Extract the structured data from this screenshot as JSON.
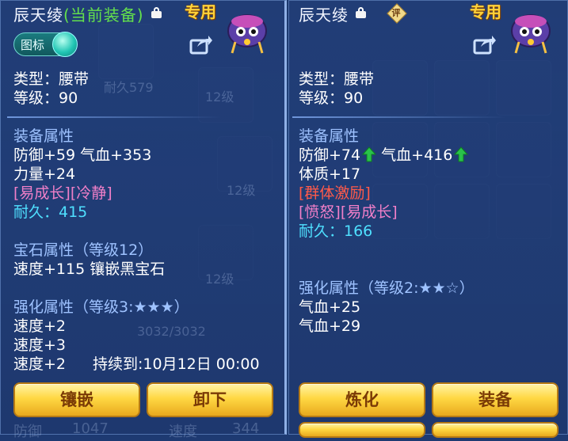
{
  "left": {
    "title": "辰天绫",
    "equipped": "(当前装备)",
    "special": "专用",
    "toggle_label": "图标",
    "type_line": "类型：腰带",
    "level_line": "等级：90",
    "equip_header": "装备属性",
    "attr1": "防御+59 气血+353",
    "attr2": "力量+24",
    "tags": "[易成长][冷静]",
    "durability": "耐久：415",
    "gem_header": "宝石属性（等级12）",
    "gem_line": "速度+115 镶嵌黑宝石",
    "enh_header": "强化属性（等级3:★★★）",
    "enh1": "速度+2",
    "enh2": "速度+3",
    "enh3": "速度+2",
    "expire": "持续到:10月12日 00:00",
    "btn_inlay": "镶嵌",
    "btn_remove": "卸下"
  },
  "right": {
    "title": "辰天绫",
    "rate_label": "评",
    "special": "专用",
    "type_line": "类型：腰带",
    "level_line": "等级：90",
    "equip_header": "装备属性",
    "attr_def": "防御+74",
    "attr_hp": "气血+416",
    "attr2": "体质+17",
    "tag_red": "[群体激励]",
    "tags": "[愤怒][易成长]",
    "durability": "耐久：166",
    "enh_header": "强化属性（等级2:★★☆）",
    "enh1": "气血+25",
    "enh2": "气血+29",
    "btn_refine": "炼化",
    "btn_equip": "装备"
  },
  "background": {
    "durability_579": "耐久579",
    "level_12a": "12级",
    "level_12b": "12级",
    "level_12c": "12级",
    "hp_bar": "3032/3032",
    "defense": "防御",
    "defense_val": "1047",
    "speed": "速度",
    "speed_val": "344"
  },
  "colors": {
    "equipped_green": "#63e04c",
    "special_gold": "#ffd23a",
    "header_blue": "#9ec2ff",
    "tag_pink": "#f07fc8",
    "durability_cyan": "#4fe0ff",
    "tag_red": "#ff5a4a",
    "up_arrow_green": "#29c24a"
  }
}
